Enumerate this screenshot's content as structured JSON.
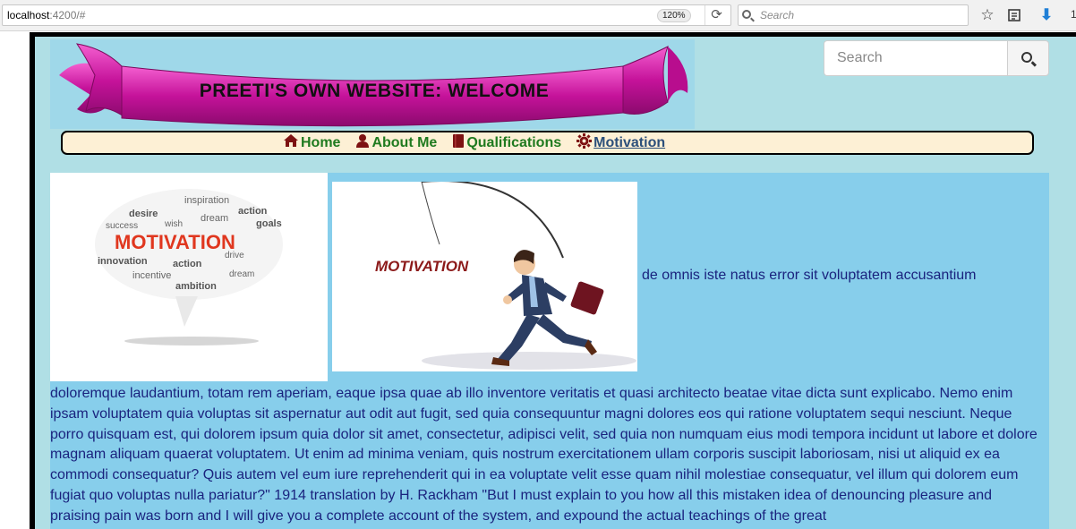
{
  "browser": {
    "url_host": "localhost",
    "url_path": ":4200/#",
    "zoom": "120%",
    "search_placeholder": "Search",
    "overflow_count": "1"
  },
  "banner": {
    "title": "PREETI'S OWN WEBSITE: WELCOME"
  },
  "site_search": {
    "placeholder": "Search"
  },
  "nav": {
    "items": [
      {
        "label": "Home",
        "icon": "home-icon"
      },
      {
        "label": "About Me",
        "icon": "user-icon"
      },
      {
        "label": "Qualifications",
        "icon": "book-icon"
      },
      {
        "label": "Motivation",
        "icon": "cog-icon"
      }
    ],
    "active": "Motivation"
  },
  "content": {
    "image1_word": "MOTIVATION",
    "image1_words": [
      "inspiration",
      "desire",
      "dream",
      "action",
      "success",
      "wish",
      "goals",
      "innovation",
      "incentive",
      "ambition",
      "drive"
    ],
    "image2_word": "MOTIVATION",
    "inline_text": "de omnis iste natus error sit voluptatem accusantium",
    "paragraph": "doloremque laudantium, totam rem aperiam, eaque ipsa quae ab illo inventore veritatis et quasi architecto beatae vitae dicta sunt explicabo. Nemo enim ipsam voluptatem quia voluptas sit aspernatur aut odit aut fugit, sed quia consequuntur magni dolores eos qui ratione voluptatem sequi nesciunt. Neque porro quisquam est, qui dolorem ipsum quia dolor sit amet, consectetur, adipisci velit, sed quia non numquam eius modi tempora incidunt ut labore et dolore magnam aliquam quaerat voluptatem. Ut enim ad minima veniam, quis nostrum exercitationem ullam corporis suscipit laboriosam, nisi ut aliquid ex ea commodi consequatur? Quis autem vel eum iure reprehenderit qui in ea voluptate velit esse quam nihil molestiae consequatur, vel illum qui dolorem eum fugiat quo voluptas nulla pariatur?\" 1914 translation by H. Rackham \"But I must explain to you how all this mistaken idea of denouncing pleasure and praising pain was born and I will give you a complete account of the system, and expound the actual teachings of the great"
  }
}
